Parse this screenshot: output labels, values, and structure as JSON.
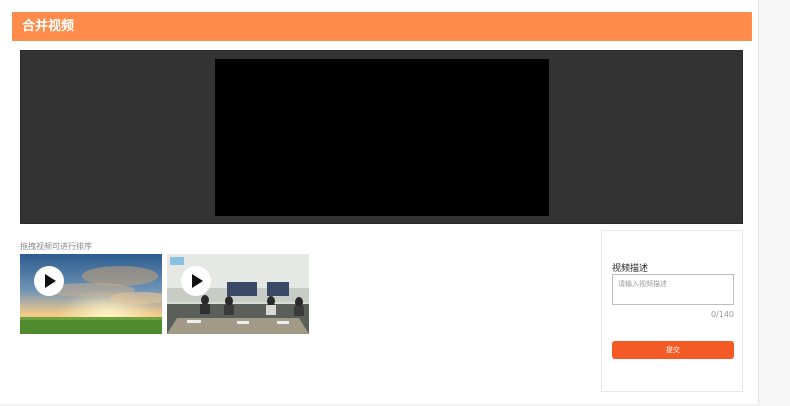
{
  "header": {
    "title": "合并视频"
  },
  "player": {
    "state": "empty"
  },
  "clips": {
    "hint": "拖拽视频可进行排序",
    "items": [
      {
        "scene": "sky-landscape"
      },
      {
        "scene": "meeting-room"
      }
    ]
  },
  "description": {
    "title": "视频描述",
    "placeholder": "请输入视频描述",
    "value": "",
    "counter": "0/140",
    "submit_label": "提交"
  },
  "colors": {
    "header": "#ff8c4a",
    "submit": "#f35a25",
    "player_frame": "#333333",
    "player_screen": "#000000"
  }
}
